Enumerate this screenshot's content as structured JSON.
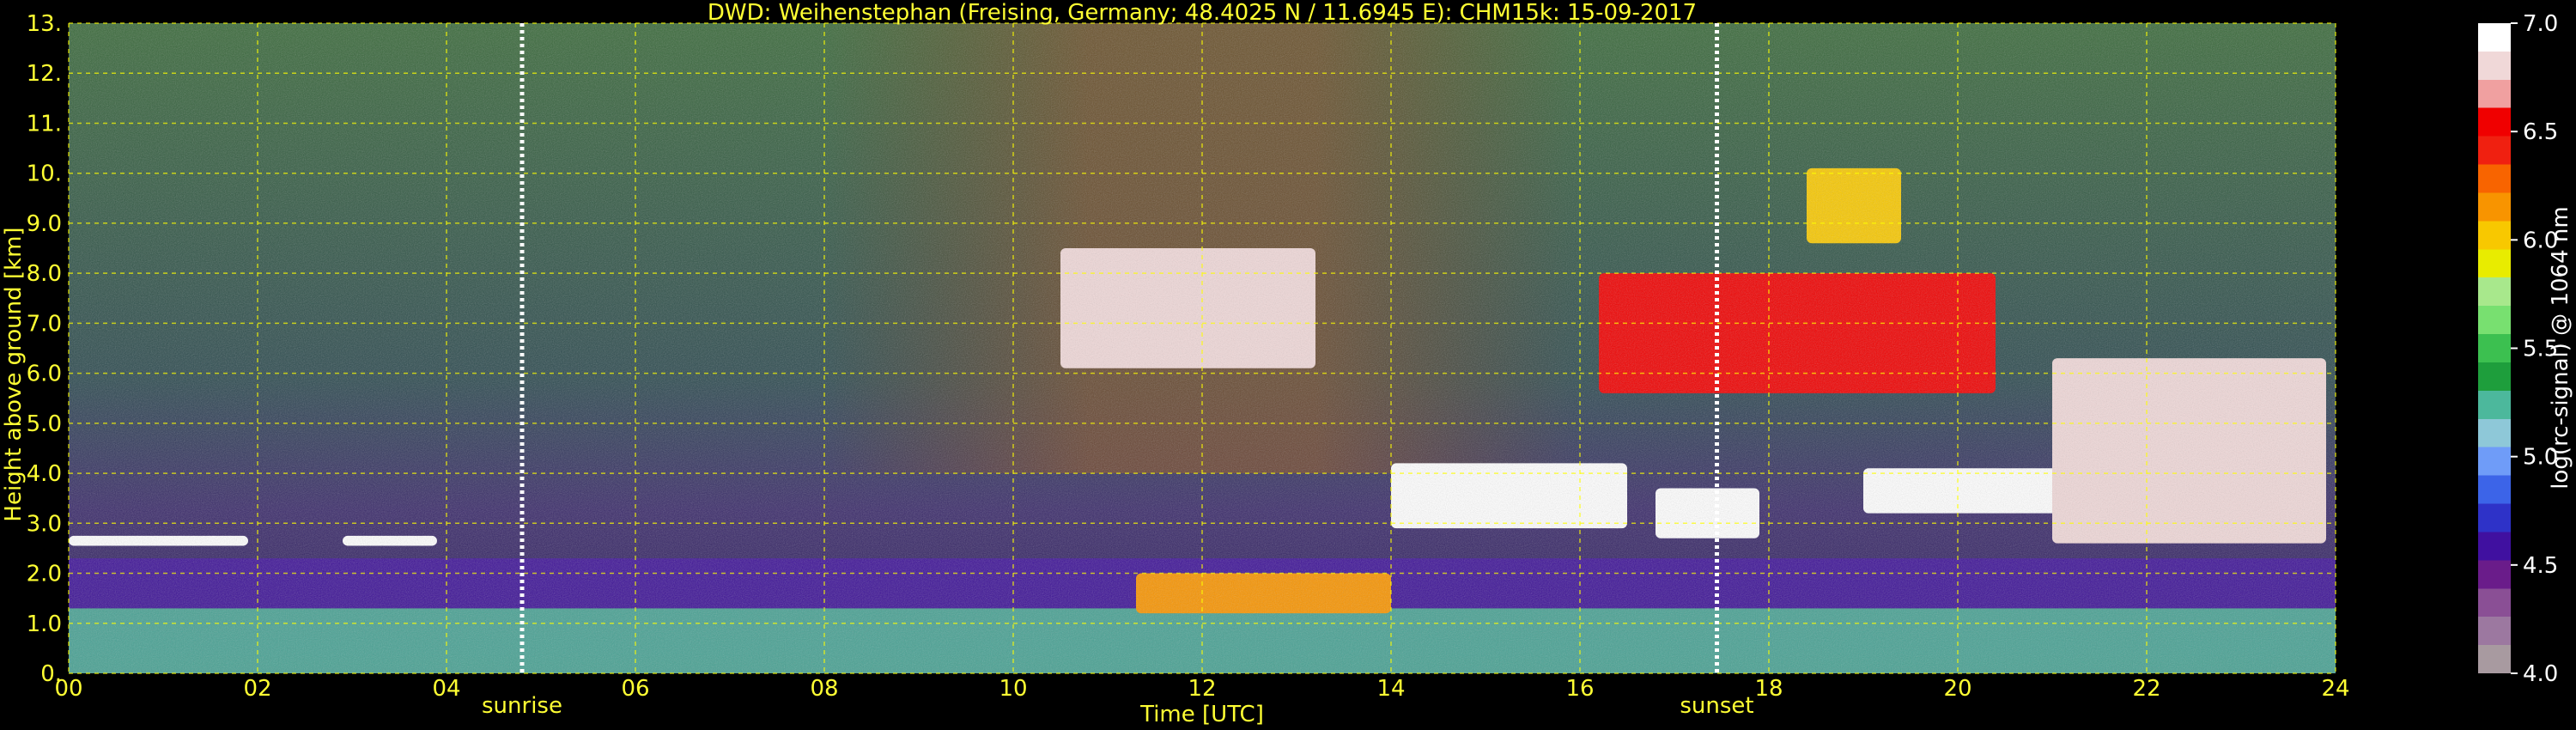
{
  "chart_data": {
    "type": "heatmap",
    "title": "DWD: Weihenstephan (Freising, Germany; 48.4025 N / 11.6945 E):    CHM15k: 15-09-2017",
    "xlabel": "Time [UTC]",
    "ylabel": "Height above ground [km]",
    "xlim": [
      0,
      24
    ],
    "ylim": [
      0,
      13
    ],
    "x_ticks": [
      "00",
      "02",
      "04",
      "06",
      "08",
      "10",
      "12",
      "14",
      "16",
      "18",
      "20",
      "22",
      "24"
    ],
    "y_ticks": [
      "0.",
      "1.0",
      "2.0",
      "3.0",
      "4.0",
      "5.0",
      "6.0",
      "7.0",
      "8.0",
      "9.0",
      "10.",
      "11.",
      "12.",
      "13."
    ],
    "grid": true,
    "grid_color": "#ffff00",
    "background": "#000000",
    "text_color": "#ffff33",
    "markers": [
      {
        "label": "sunrise",
        "x": 4.8
      },
      {
        "label": "sunset",
        "x": 17.45
      }
    ],
    "colorbar": {
      "label": "log(rc-signal) @ 1064 nm",
      "range": [
        4.0,
        7.0
      ],
      "ticks": [
        "4.0",
        "4.5",
        "5.0",
        "5.5",
        "6.0",
        "6.5",
        "7.0"
      ],
      "colors": [
        "#a89aa0",
        "#9c78a0",
        "#8a4f95",
        "#6a1c8a",
        "#4010a0",
        "#2e32c8",
        "#3c64e8",
        "#6f9cf8",
        "#8ec8d8",
        "#4cb89c",
        "#1e9e3c",
        "#3cc050",
        "#78e070",
        "#a8e88c",
        "#e8ec00",
        "#f8c800",
        "#f89400",
        "#f86400",
        "#f02010",
        "#f00000",
        "#f0a0a0",
        "#f0d8d8",
        "#ffffff"
      ]
    },
    "features": [
      {
        "name": "boundary-layer",
        "x": [
          0,
          24
        ],
        "y": [
          0,
          1.3
        ],
        "level": 5.2
      },
      {
        "name": "residual-layer",
        "x": [
          0,
          24
        ],
        "y": [
          1.3,
          2.3
        ],
        "level": 4.6
      },
      {
        "name": "cloud-morning-1",
        "x": [
          0,
          1.9
        ],
        "y": [
          2.55,
          2.75
        ],
        "level": 7.0
      },
      {
        "name": "cloud-morning-2",
        "x": [
          2.9,
          3.9
        ],
        "y": [
          2.55,
          2.75
        ],
        "level": 7.0
      },
      {
        "name": "cloud-mid-1",
        "x": [
          11.3,
          14.0
        ],
        "y": [
          1.2,
          2.0
        ],
        "level": 6.2
      },
      {
        "name": "cloud-4km",
        "x": [
          14.0,
          16.5
        ],
        "y": [
          2.9,
          4.2
        ],
        "level": 7.0
      },
      {
        "name": "cloud-3km",
        "x": [
          16.8,
          17.9
        ],
        "y": [
          2.7,
          3.7
        ],
        "level": 7.0
      },
      {
        "name": "cirrus-7km",
        "x": [
          16.2,
          20.4
        ],
        "y": [
          5.6,
          8.0
        ],
        "level": 6.5
      },
      {
        "name": "cloud-evening-3_5km",
        "x": [
          19.0,
          21.7
        ],
        "y": [
          3.2,
          4.1
        ],
        "level": 7.0
      },
      {
        "name": "cloud-evening-5km",
        "x": [
          21.0,
          23.9
        ],
        "y": [
          2.6,
          6.3
        ],
        "level": 6.8
      },
      {
        "name": "cirrus-9km",
        "x": [
          18.4,
          19.4
        ],
        "y": [
          8.6,
          10.1
        ],
        "level": 6.0
      },
      {
        "name": "cirrus-8km-noon",
        "x": [
          10.5,
          13.2
        ],
        "y": [
          6.1,
          8.5
        ],
        "level": 6.8
      }
    ]
  }
}
